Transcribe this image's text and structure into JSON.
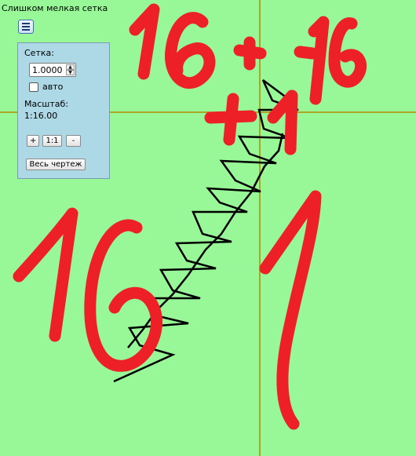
{
  "status_message": "Слишком мелкая сетка",
  "panel": {
    "grid_label": "Сетка:",
    "grid_value": "1.0000",
    "auto_label": "авто",
    "auto_checked": false,
    "scale_label": "Масштаб:",
    "scale_value": "1:16.00",
    "zoom_in": "+",
    "zoom_reset": "1:1",
    "zoom_out": "-",
    "fit_all": "Весь чертеж"
  },
  "colors": {
    "background": "#98f898",
    "axis": "#b08a00",
    "ink_red": "#ee2027",
    "ink_black": "#000000"
  },
  "icons": [
    "hamburger-menu-icon",
    "spinner-up-icon",
    "spinner-down-icon"
  ]
}
